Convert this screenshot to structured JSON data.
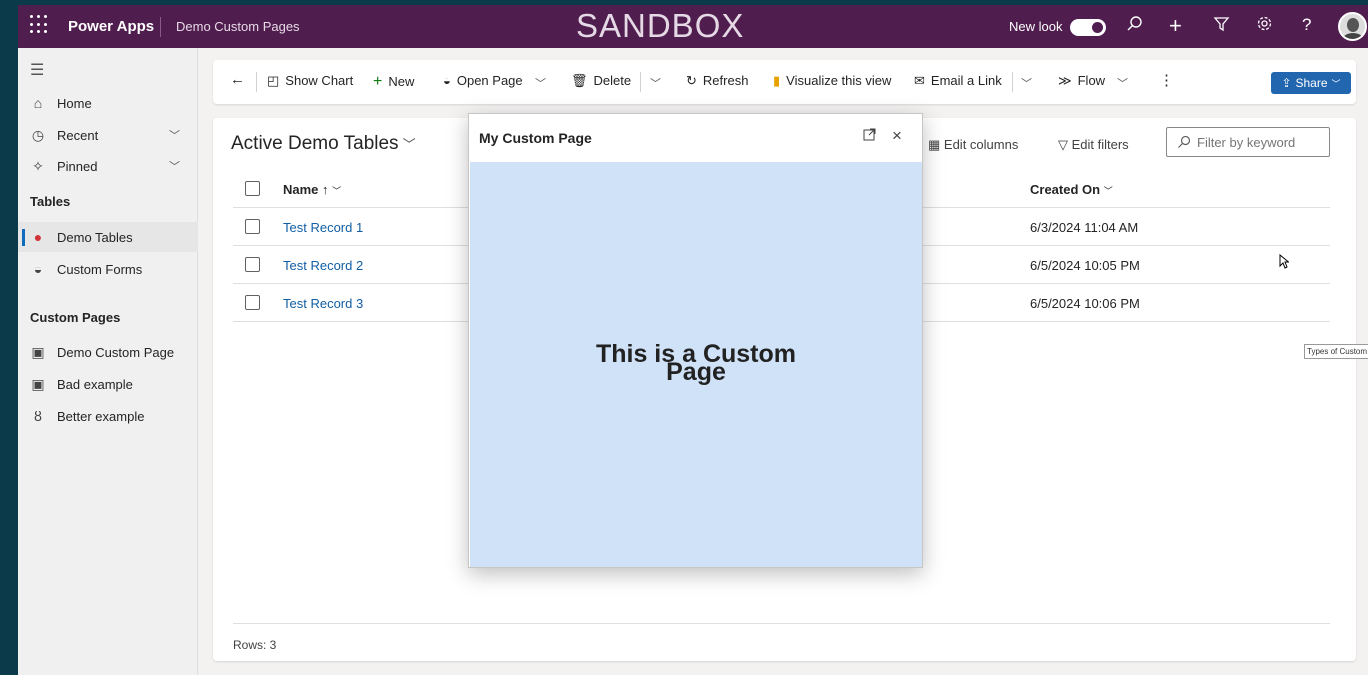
{
  "header": {
    "brand": "Power Apps",
    "app_name": "Demo Custom Pages",
    "environment": "SANDBOX",
    "new_look_label": "New look",
    "new_look_enabled": true,
    "icons": [
      "waffle-icon",
      "search-icon",
      "plus-icon",
      "filter-icon",
      "gear-icon",
      "help-icon",
      "avatar"
    ]
  },
  "sidebar": {
    "items": [
      {
        "label": "Home",
        "icon": "home-icon"
      },
      {
        "label": "Recent",
        "icon": "clock-icon"
      },
      {
        "label": "Pinned",
        "icon": "pin-icon"
      }
    ],
    "sections": [
      {
        "title": "Tables",
        "items": [
          {
            "label": "Demo Tables",
            "icon": "entity-icon",
            "active": true
          },
          {
            "label": "Custom Forms",
            "icon": "entity-icon"
          }
        ]
      },
      {
        "title": "Custom Pages",
        "items": [
          {
            "label": "Demo Custom Page",
            "icon": "page-icon"
          },
          {
            "label": "Bad example",
            "icon": "page-icon"
          },
          {
            "label": "Better example",
            "icon": "binoculars-icon"
          }
        ]
      }
    ]
  },
  "commands": {
    "show_chart": "Show Chart",
    "new": "New",
    "open_page": "Open Page",
    "delete": "Delete",
    "refresh": "Refresh",
    "visualize": "Visualize this view",
    "email_link": "Email a Link",
    "flow": "Flow",
    "share": "Share"
  },
  "view": {
    "title": "Active Demo Tables",
    "edit_columns": "Edit columns",
    "edit_filters": "Edit filters",
    "filter_placeholder": "Filter by keyword",
    "columns": [
      "Name ↑",
      "Created On"
    ],
    "rows": [
      {
        "name": "Test Record 1",
        "created": "6/3/2024 11:04 AM"
      },
      {
        "name": "Test Record 2",
        "created": "6/5/2024 10:05 PM"
      },
      {
        "name": "Test Record 3",
        "created": "6/5/2024 10:06 PM"
      }
    ],
    "rows_count": "Rows: 3"
  },
  "dialog": {
    "title": "My Custom Page",
    "body_text": "This is a Custom Page"
  },
  "tooltip": "Types of Custom",
  "colors": {
    "header_bg": "#4f1d4e",
    "accent": "#0f6cbd",
    "dialog_body": "#cfe2f8",
    "link": "#115ea3"
  }
}
